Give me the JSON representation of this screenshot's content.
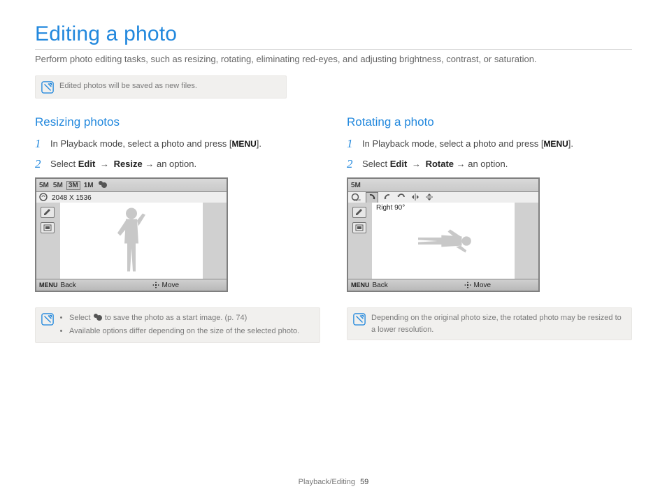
{
  "title": "Editing a photo",
  "intro": "Perform photo editing tasks, such as resizing, rotating, eliminating red-eyes, and adjusting brightness, contrast, or saturation.",
  "topnote": "Edited photos will be saved as new files.",
  "left": {
    "heading": "Resizing photos",
    "step1_pre": "In Playback mode, select a photo and press [",
    "step1_menu": "MENU",
    "step1_post": "].",
    "step2_pre": "Select ",
    "step2_b1": "Edit",
    "step2_arrow": "→",
    "step2_b2": "Resize",
    "step2_post": " → an option.",
    "cam": {
      "resolutions": [
        "5M",
        "5M",
        "3M",
        "1M"
      ],
      "selected_index": 2,
      "size_text": "2048 X 1536",
      "back": "Back",
      "move": "Move",
      "menu_glyph": "MENU"
    },
    "note": {
      "li1_pre": "Select ",
      "li1_post": " to save the photo as a start image. (p. 74)",
      "li2": "Available options differ depending on the size of the selected photo."
    }
  },
  "right": {
    "heading": "Rotating a photo",
    "step1_pre": "In Playback mode, select a photo and press [",
    "step1_menu": "MENU",
    "step1_post": "].",
    "step2_pre": "Select ",
    "step2_b1": "Edit",
    "step2_arrow": "→",
    "step2_b2": "Rotate",
    "step2_post": " → an option.",
    "cam": {
      "top_text": "5M",
      "label": "Right 90°",
      "back": "Back",
      "move": "Move",
      "menu_glyph": "MENU"
    },
    "note": "Depending on the original photo size, the rotated photo may be resized to a lower resolution."
  },
  "footer": {
    "section": "Playback/Editing",
    "page": "59"
  }
}
